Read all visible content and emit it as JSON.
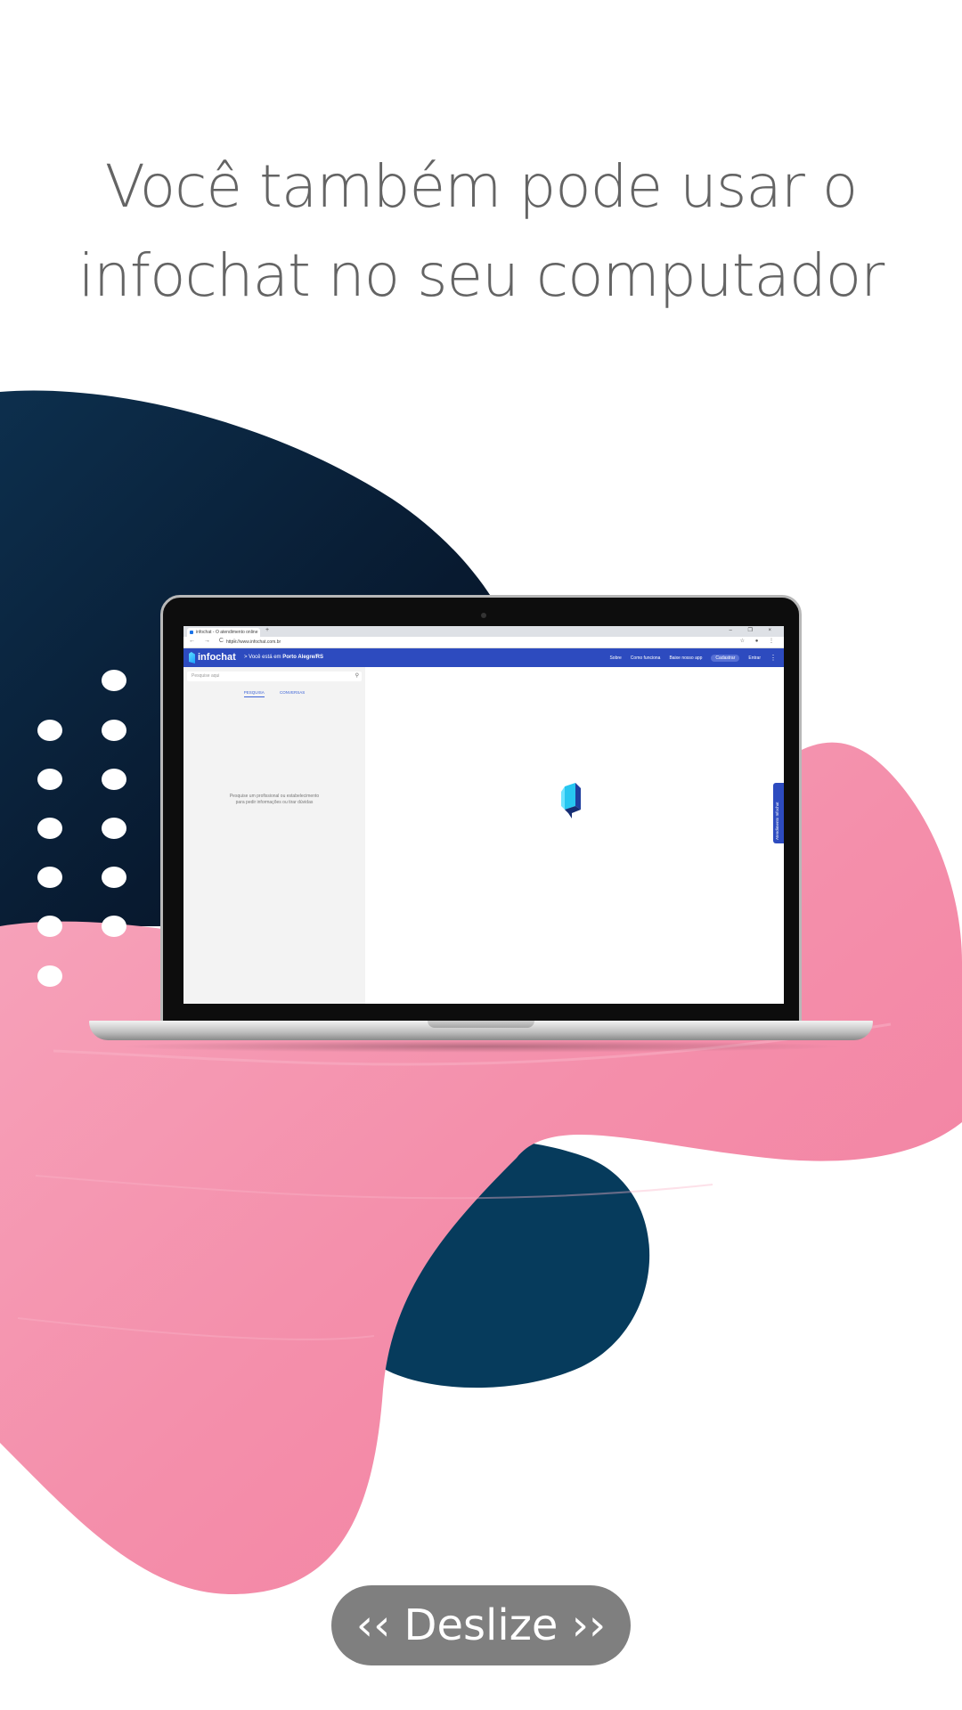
{
  "headline": {
    "line1": "Você também pode usar o",
    "line2": "infochat no seu computador"
  },
  "laptop_screen": {
    "browser": {
      "tab_title": "infochat - O atendimento online",
      "tab_icon": "infochat-favicon",
      "new_tab": "+",
      "window_controls": "– ❐ ×",
      "nav_icons": "← → C ⌂",
      "url": "https://www.infochat.com.br",
      "addr_right_icons": "☆ ● ⋮"
    },
    "appbar": {
      "logo_text": "infochat",
      "location_prefix": "Você está em",
      "location_city": "Porto Alegre/RS",
      "menu": [
        "Sobre",
        "Como funciona",
        "Baixe nosso app",
        "Cadastrar",
        "Entrar"
      ],
      "kebab": "⋮",
      "color": "#2d4bbf"
    },
    "sidebar": {
      "search_placeholder": "Pesquise aqui",
      "search_icon": "search-icon",
      "tabs": [
        "PESQUISA",
        "CONVERSAS"
      ],
      "active_tab": "PESQUISA",
      "empty_message_line1": "Pesquise um profissional ou estabelecimento",
      "empty_message_line2": "para pedir informações ou tirar dúvidas"
    },
    "support_tab_label": "Atendimento Infochat"
  },
  "swipe_button": {
    "label": "‹‹ Deslize ››"
  },
  "colors": {
    "navy": "#0b2540",
    "pink": "#f48fab",
    "headline_text": "#646464",
    "button_bg": "#7f7f7f"
  }
}
